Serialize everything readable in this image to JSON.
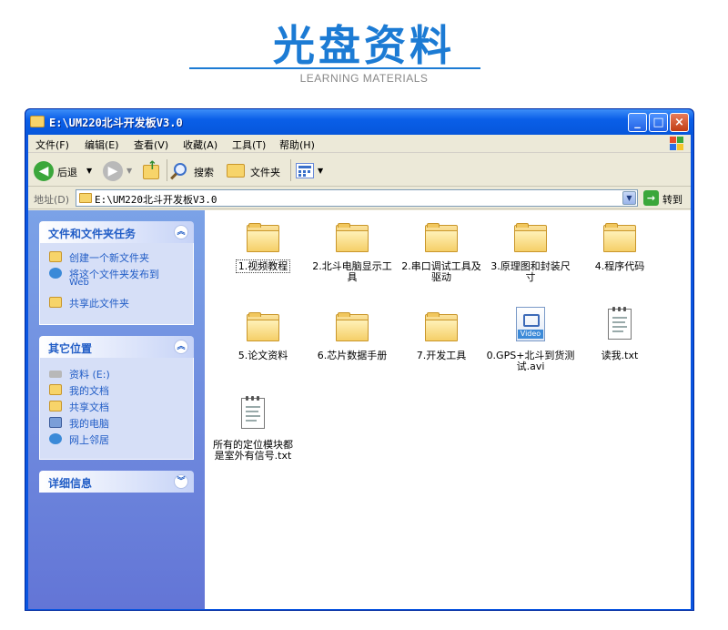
{
  "banner": {
    "title": "光盘资料",
    "subtitle": "LEARNING MATERIALS"
  },
  "window": {
    "title": "E:\\UM220北斗开发板V3.0",
    "buttons": {
      "minimize": "_",
      "maximize": "□",
      "close": "×"
    }
  },
  "menu": {
    "items": [
      "文件(F)",
      "编辑(E)",
      "查看(V)",
      "收藏(A)",
      "工具(T)",
      "帮助(H)"
    ]
  },
  "toolbar": {
    "back_label": "后退",
    "search_label": "搜索",
    "folders_label": "文件夹"
  },
  "address": {
    "label": "地址(D)",
    "value": "E:\\UM220北斗开发板V3.0",
    "go_label": "转到"
  },
  "sidebar": {
    "tasks": {
      "title": "文件和文件夹任务",
      "items": [
        "创建一个新文件夹",
        "将这个文件夹发布到",
        "Web",
        "共享此文件夹"
      ]
    },
    "places": {
      "title": "其它位置",
      "items": [
        "资料 (E:)",
        "我的文档",
        "共享文档",
        "我的电脑",
        "网上邻居"
      ]
    },
    "details": {
      "title": "详细信息"
    }
  },
  "files": [
    {
      "name": "1.视频教程",
      "line2": "",
      "type": "folder"
    },
    {
      "name": "2.北斗电脑显示工",
      "line2": "具",
      "type": "folder"
    },
    {
      "name": "2.串口调试工具及",
      "line2": "驱动",
      "type": "folder"
    },
    {
      "name": "3.原理图和封装尺",
      "line2": "寸",
      "type": "folder"
    },
    {
      "name": "4.程序代码",
      "line2": "",
      "type": "folder"
    },
    {
      "name": "5.论文资料",
      "line2": "",
      "type": "folder"
    },
    {
      "name": "6.芯片数据手册",
      "line2": "",
      "type": "folder"
    },
    {
      "name": "7.开发工具",
      "line2": "",
      "type": "folder"
    },
    {
      "name": "0.GPS+北斗到货测",
      "line2": "试.avi",
      "type": "video",
      "badge": "Video"
    },
    {
      "name": "读我.txt",
      "line2": "",
      "type": "text"
    },
    {
      "name": "所有的定位模块都",
      "line2": "是室外有信号.txt",
      "type": "text"
    }
  ],
  "colors": {
    "banner_blue": "#1c7bd4",
    "xp_title_blue": "#0a5fe8",
    "sidebar_blue": "#6375d6",
    "link_blue": "#215dc6"
  }
}
